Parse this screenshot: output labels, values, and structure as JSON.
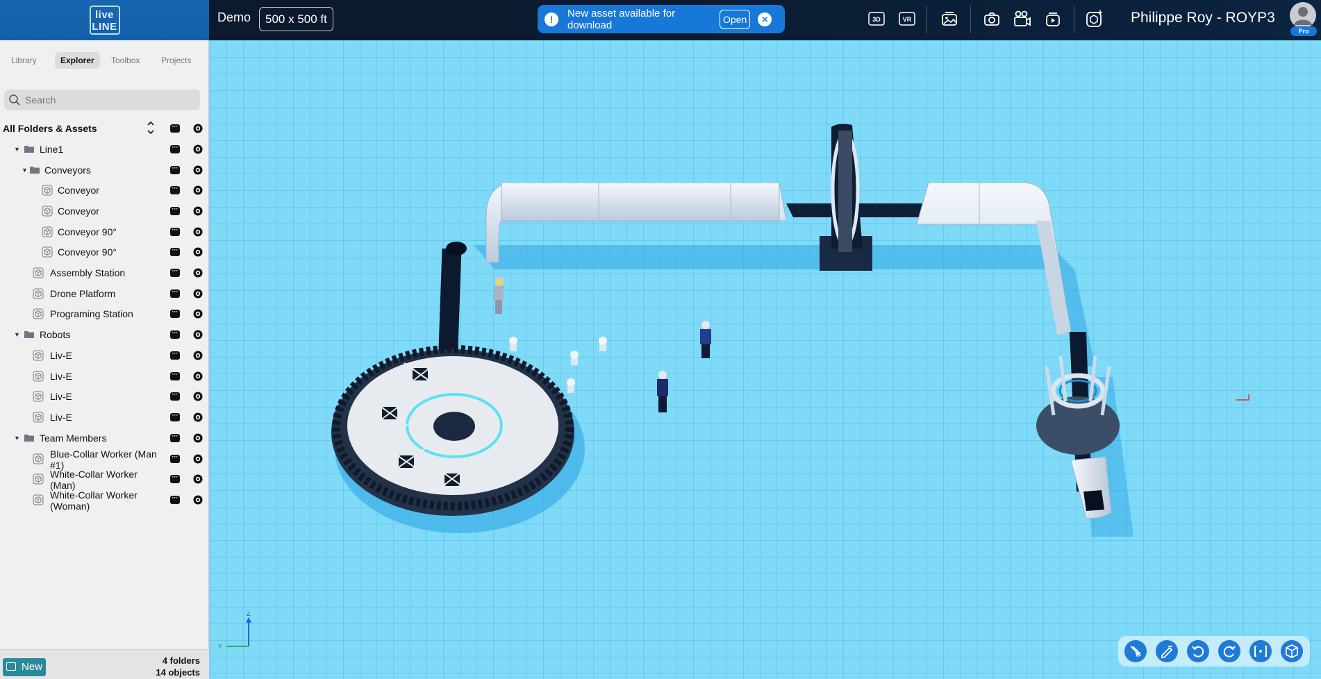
{
  "app": {
    "logo_text": "live LINE",
    "project_name": "Demo",
    "size_label": "500 x 500 ft"
  },
  "notification": {
    "text": "New asset available for download",
    "open_label": "Open"
  },
  "toolbar_top": {
    "view_3d": "3D",
    "view_vr": "VR"
  },
  "user": {
    "name": "Philippe Roy - ROYP3",
    "badge": "Pro"
  },
  "sidebar": {
    "tabs": [
      "Library",
      "Explorer",
      "Toolbox",
      "Projects"
    ],
    "active_tab": "Explorer",
    "search_placeholder": "Search",
    "root_label": "All Folders & Assets",
    "tree": [
      {
        "label": "Line1",
        "type": "folder",
        "level": 1
      },
      {
        "label": "Conveyors",
        "type": "folder",
        "level": 2
      },
      {
        "label": "Conveyor",
        "type": "asset",
        "level": 3
      },
      {
        "label": "Conveyor",
        "type": "asset",
        "level": 3
      },
      {
        "label": "Conveyor 90°",
        "type": "asset",
        "level": 3
      },
      {
        "label": "Conveyor 90°",
        "type": "asset",
        "level": 3
      },
      {
        "label": "Assembly Station",
        "type": "asset",
        "level": 2
      },
      {
        "label": "Drone Platform",
        "type": "asset",
        "level": 2
      },
      {
        "label": "Programing Station",
        "type": "asset",
        "level": 2
      },
      {
        "label": "Robots",
        "type": "folder",
        "level": 1
      },
      {
        "label": "Liv-E",
        "type": "asset",
        "level": 2
      },
      {
        "label": "Liv-E",
        "type": "asset",
        "level": 2
      },
      {
        "label": "Liv-E",
        "type": "asset",
        "level": 2
      },
      {
        "label": "Liv-E",
        "type": "asset",
        "level": 2
      },
      {
        "label": "Team Members",
        "type": "folder",
        "level": 1
      },
      {
        "label": "Blue-Collar Worker (Man #1)",
        "type": "asset",
        "level": 2
      },
      {
        "label": "White-Collar Worker (Man)",
        "type": "asset",
        "level": 2
      },
      {
        "label": "White-Collar Worker (Woman)",
        "type": "asset",
        "level": 2
      }
    ],
    "new_label": "New",
    "folders_count": "4 folders",
    "objects_count": "14 objects"
  },
  "viewport": {
    "axis_z": "Z",
    "axis_y": "Y",
    "tools": [
      "select-off-icon",
      "edit-icon",
      "undo-icon",
      "redo-icon",
      "focus-icon",
      "cube-view-icon"
    ]
  },
  "colors": {
    "accent": "#1878d8",
    "floor": "#7fdaf8",
    "topbar": "#0d1a2b",
    "sidebar": "#f0f0f0"
  }
}
